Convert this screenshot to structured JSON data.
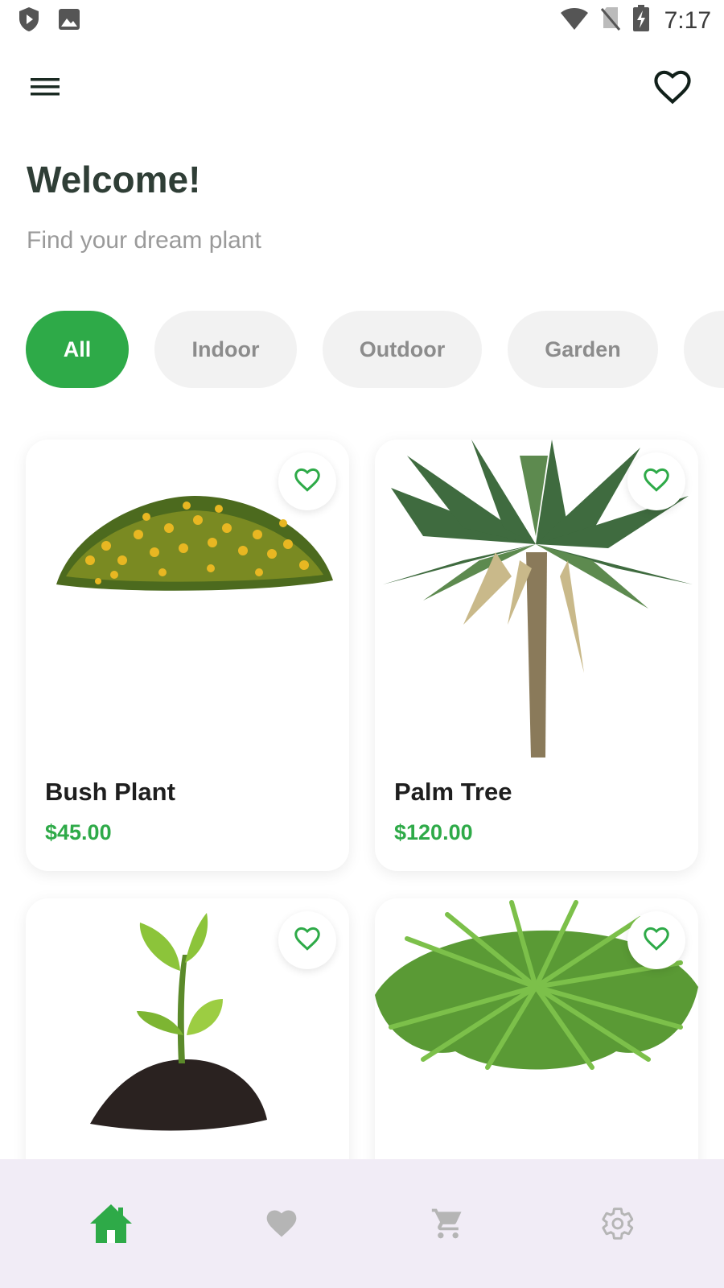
{
  "status_bar": {
    "time": "7:17",
    "left_icons": [
      "shield-play-icon",
      "image-icon"
    ],
    "right_icons": [
      "wifi-icon",
      "no-sim-icon",
      "battery-charging-icon"
    ]
  },
  "app_bar": {
    "menu_icon": "menu-icon",
    "favorites_icon": "heart-outline-icon"
  },
  "header": {
    "title": "Welcome!",
    "subtitle": "Find your dream plant"
  },
  "categories": [
    {
      "label": "All",
      "active": true
    },
    {
      "label": "Indoor",
      "active": false
    },
    {
      "label": "Outdoor",
      "active": false
    },
    {
      "label": "Garden",
      "active": false
    },
    {
      "label": "",
      "active": false
    }
  ],
  "products": [
    {
      "name": "Bush Plant",
      "price": "$45.00",
      "image": "bush-plant-image",
      "favorite_icon": "heart-outline-icon"
    },
    {
      "name": "Palm Tree",
      "price": "$120.00",
      "image": "palm-tree-image",
      "favorite_icon": "heart-outline-icon"
    },
    {
      "name": "",
      "price": "",
      "image": "sprout-in-soil-image",
      "favorite_icon": "heart-outline-icon"
    },
    {
      "name": "",
      "price": "",
      "image": "fern-image",
      "favorite_icon": "heart-outline-icon"
    }
  ],
  "bottom_nav": {
    "items": [
      {
        "icon": "home-icon",
        "active": true
      },
      {
        "icon": "heart-icon",
        "active": false
      },
      {
        "icon": "cart-icon",
        "active": false
      },
      {
        "icon": "settings-icon",
        "active": false
      }
    ]
  },
  "colors": {
    "accent": "#2eaa48",
    "title": "#2f3e36",
    "subtitle": "#9a9a9a",
    "chip_inactive_bg": "#f2f2f2",
    "chip_inactive_text": "#8c8c8c",
    "nav_bg": "#f1ecf6",
    "nav_inactive": "#b5b5b5"
  }
}
